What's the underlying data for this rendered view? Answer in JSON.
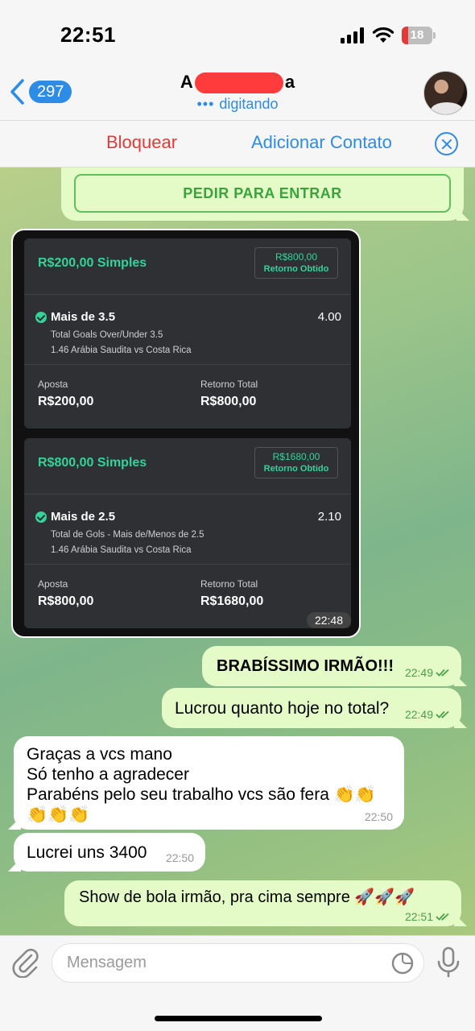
{
  "status_bar": {
    "time": "22:51",
    "battery": "18"
  },
  "header": {
    "back_count": "297",
    "contact_name_prefix": "A",
    "contact_name_suffix": "a",
    "status": "digitando"
  },
  "action_bar": {
    "block_label": "Bloquear",
    "add_contact_label": "Adicionar Contato"
  },
  "colors": {
    "accent": "#2d8ce6",
    "danger": "#e53935",
    "bet_green": "#34d399",
    "bubble_out": "#e4fbc8"
  },
  "join_button": {
    "label": "PEDIR PARA ENTRAR"
  },
  "bet_image": {
    "time": "22:48",
    "bets": [
      {
        "stake_label": "R$200,00 Simples",
        "return_value": "R$800,00",
        "return_label": "Retorno Obtido",
        "selection": "Mais de 3.5",
        "odds": "4.00",
        "market": "Total Goals Over/Under 3.5",
        "event": "1.46 Arábia Saudita vs Costa Rica",
        "stake_title": "Aposta",
        "stake_value": "R$200,00",
        "total_title": "Retorno Total",
        "total_value": "R$800,00"
      },
      {
        "stake_label": "R$800,00 Simples",
        "return_value": "R$1680,00",
        "return_label": "Retorno Obtido",
        "selection": "Mais de 2.5",
        "odds": "2.10",
        "market": "Total de Gols - Mais de/Menos de 2.5",
        "event": "1.46 Arábia Saudita vs Costa Rica",
        "stake_title": "Aposta",
        "stake_value": "R$800,00",
        "total_title": "Retorno Total",
        "total_value": "R$1680,00"
      }
    ]
  },
  "messages": [
    {
      "direction": "out",
      "text": "BRABÍSSIMO IRMÃO!!!",
      "time": "22:49"
    },
    {
      "direction": "out",
      "text": "Lucrou quanto hoje no total?",
      "time": "22:49"
    },
    {
      "direction": "in",
      "lines": [
        "Graças a vcs mano",
        "Só tenho a agradecer",
        "Parabéns pelo seu trabalho vcs são fera 👏👏",
        "👏👏👏"
      ],
      "time": "22:50"
    },
    {
      "direction": "in",
      "text": "Lucrei uns 3400",
      "time": "22:50"
    },
    {
      "direction": "out",
      "text": "Show de bola irmão, pra cima sempre 🚀🚀🚀",
      "time": "22:51"
    }
  ],
  "input": {
    "placeholder": "Mensagem"
  }
}
